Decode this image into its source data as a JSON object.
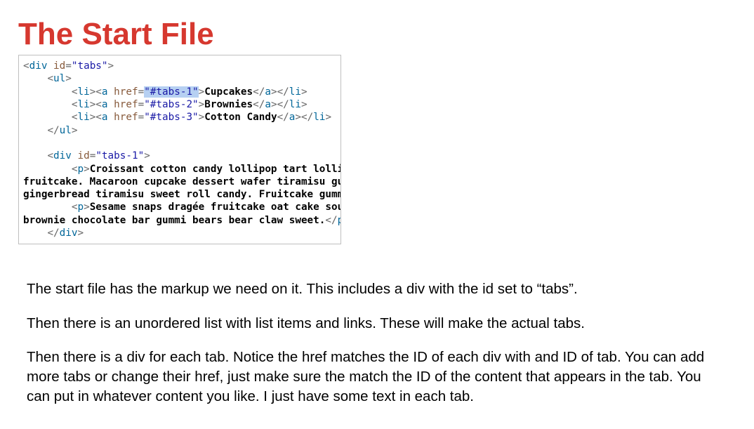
{
  "title": "The Start File",
  "code": {
    "div_open": {
      "tag": "div",
      "attr": "id",
      "value": "\"tabs\""
    },
    "ul_open": "ul",
    "items": [
      {
        "li": "li",
        "a": "a",
        "attr": "href",
        "value": "\"#tabs-1\"",
        "value_hl": true,
        "text": "Cupcakes"
      },
      {
        "li": "li",
        "a": "a",
        "attr": "href",
        "value": "\"#tabs-2\"",
        "value_hl": false,
        "text": "Brownies"
      },
      {
        "li": "li",
        "a": "a",
        "attr": "href",
        "value": "\"#tabs-3\"",
        "value_hl": false,
        "text": "Cotton Candy"
      }
    ],
    "ul_close": "ul",
    "div2_open": {
      "tag": "div",
      "attr": "id",
      "value": "\"tabs-1\""
    },
    "para1_open": "p",
    "para1_line1": "Croissant cotton candy lollipop tart lollipo",
    "para1_line2": "fruitcake. Macaroon cupcake dessert wafer tiramisu gumm",
    "para1_line3": "gingerbread tiramisu sweet roll candy. Fruitcake gummi",
    "para2_open": "p",
    "para2_line1": "Sesame snaps dragée fruitcake oat cake souff",
    "para2_line2": "brownie chocolate bar gummi bears bear claw sweet.",
    "para2_close": "p",
    "div2_close": "div"
  },
  "paragraphs": {
    "p1": "The start file has the markup we need on it. This includes a div with the id set to “tabs”.",
    "p2": "Then there is an unordered list with list items and links. These will make the actual tabs.",
    "p3": "Then there is a div for each tab. Notice the href matches the ID of each div with and ID of tab. You can add more tabs or change their href, just make sure the match the ID of the content that appears in the tab.  You can put in whatever content you like. I just have some text in each tab."
  }
}
